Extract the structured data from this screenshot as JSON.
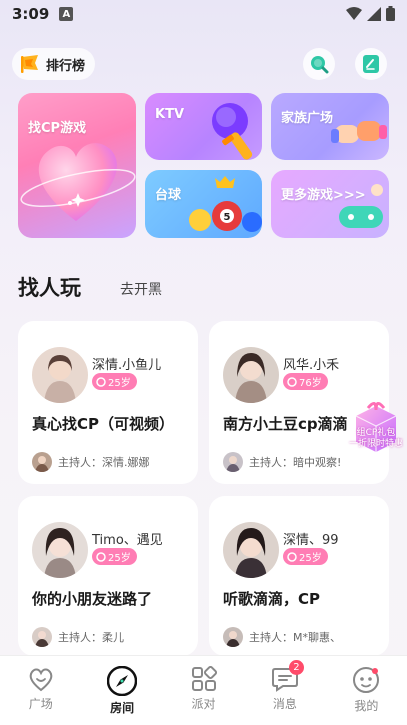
{
  "status": {
    "time": "3:09",
    "notify_letter": "A"
  },
  "header": {
    "rank_label": "排行榜"
  },
  "games": [
    {
      "label": "找CP游戏"
    },
    {
      "label": "KTV"
    },
    {
      "label": "家族广场"
    },
    {
      "label": "台球"
    },
    {
      "label": "更多游戏>>>"
    }
  ],
  "section": {
    "title": "找人玩",
    "tab_label": "去开黑"
  },
  "rooms": [
    {
      "nick": "深情.小鱼儿",
      "age": "25岁",
      "title": "真心找CP（可视频）",
      "host_prefix": "主持人：",
      "host": "深情.娜娜"
    },
    {
      "nick": "风华.小禾",
      "age": "76岁",
      "title": "南方小土豆cp滴滴",
      "host_prefix": "主持人：",
      "host": "暗中观察!"
    },
    {
      "nick": "Timo、遇见",
      "age": "25岁",
      "title": "你的小朋友迷路了",
      "host_prefix": "主持人：",
      "host": "柔儿"
    },
    {
      "nick": "深情、99",
      "age": "25岁",
      "title": "听歌滴滴，CP",
      "host_prefix": "主持人：",
      "host": "M*聊惠、"
    }
  ],
  "gift": {
    "line1": "组CP礼包",
    "line2": "一折限时特惠"
  },
  "nav": [
    {
      "label": "广场",
      "icon": "heart-icon"
    },
    {
      "label": "房间",
      "icon": "compass-icon"
    },
    {
      "label": "派对",
      "icon": "grid-icon"
    },
    {
      "label": "消息",
      "icon": "message-icon",
      "badge": "2"
    },
    {
      "label": "我的",
      "icon": "face-icon"
    }
  ],
  "colors": {
    "accent_pink": "#ff7db4",
    "badge_red": "#ff4b6a"
  }
}
